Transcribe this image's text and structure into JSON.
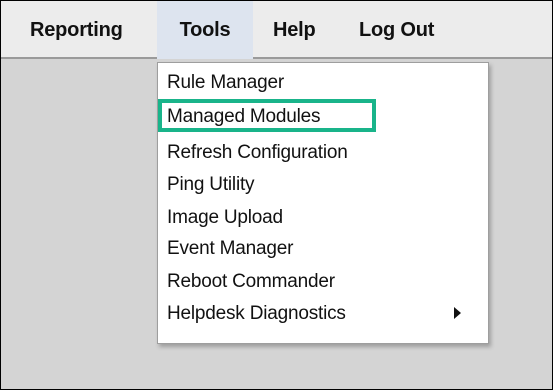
{
  "menubar": {
    "items": [
      {
        "label": "Reporting"
      },
      {
        "label": "Tools"
      },
      {
        "label": "Help"
      },
      {
        "label": "Log Out"
      }
    ]
  },
  "tools_menu": {
    "items": [
      {
        "label": "Rule Manager"
      },
      {
        "label": "Managed Modules",
        "highlighted": true
      },
      {
        "label": "Refresh Configuration"
      },
      {
        "label": "Ping Utility"
      },
      {
        "label": "Image Upload"
      },
      {
        "label": "Event Manager"
      },
      {
        "label": "Reboot Commander"
      },
      {
        "label": "Helpdesk Diagnostics",
        "has_submenu": true,
        "submenu_icon": "chevron-right-icon"
      }
    ]
  },
  "colors": {
    "menubar_bg": "#ececec",
    "active_menu_bg": "#dde4ef",
    "workspace_bg": "#d4d4d4",
    "highlight_border": "#19b48a"
  }
}
